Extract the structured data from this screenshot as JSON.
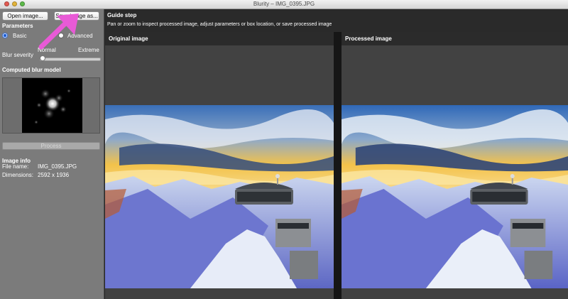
{
  "window": {
    "title": "Blurity – IMG_0395.JPG"
  },
  "toolbar": {
    "open_label": "Open image...",
    "save_label": "Save image as..."
  },
  "parameters": {
    "title": "Parameters",
    "mode_basic": "Basic",
    "mode_advanced": "Advanced",
    "selected_mode": "Basic",
    "severity_label": "Blur severity",
    "severity_min": "Normal",
    "severity_max": "Extreme",
    "severity_level": 0
  },
  "blur_model": {
    "title": "Computed blur model"
  },
  "process": {
    "label": "Process"
  },
  "image_info": {
    "title": "Image info",
    "file_key": "File name:",
    "file_value": "IMG_0395.JPG",
    "dims_key": "Dimensions:",
    "dims_value": "2592 x 1936"
  },
  "guide": {
    "title": "Guide step",
    "description": "Pan or zoom to inspect processed image, adjust parameters or box location, or save processed image"
  },
  "panes": {
    "original_title": "Original image",
    "processed_title": "Processed image"
  },
  "colors": {
    "accent": "#1d5fd6",
    "annotation_arrow": "#e85ad6",
    "sidebar": "#7b7b7b",
    "pane": "#424242"
  },
  "annotation": {
    "icon": "arrow-pointer-icon"
  }
}
